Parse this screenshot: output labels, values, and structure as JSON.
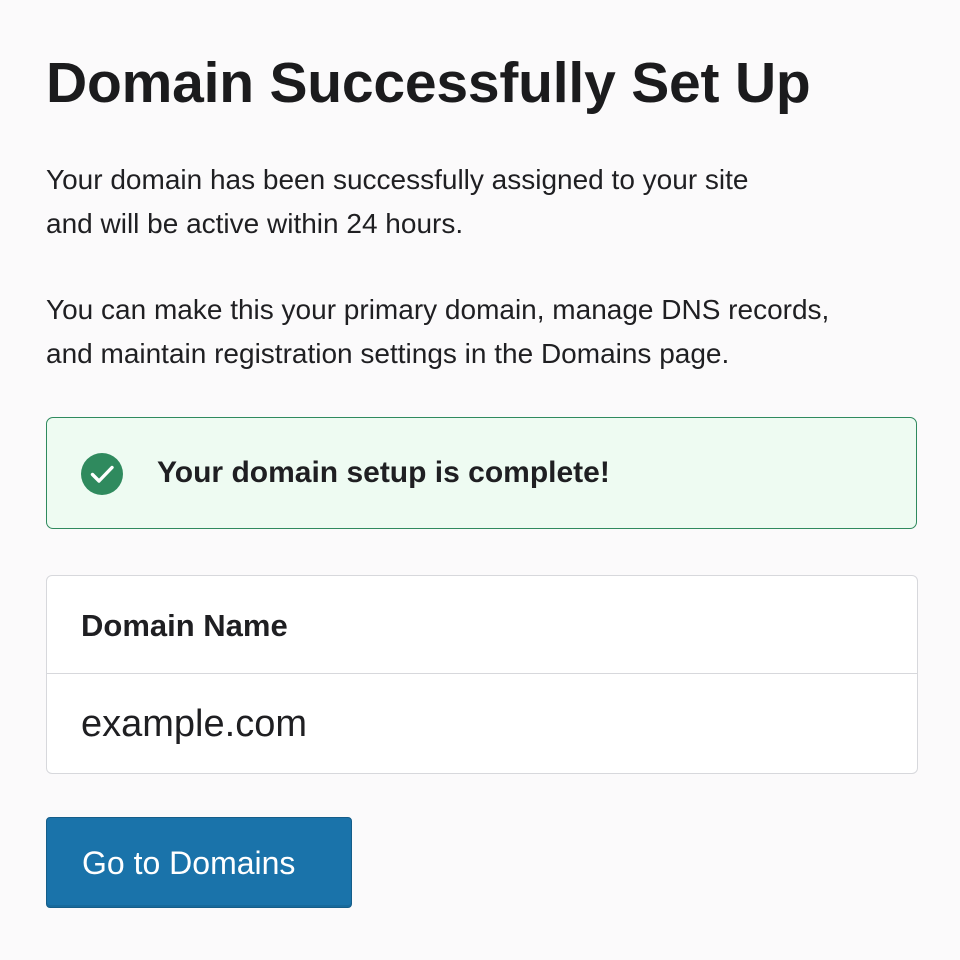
{
  "header": {
    "title": "Domain Successfully Set Up"
  },
  "content": {
    "paragraphs": [
      {
        "lines": [
          "Your domain has been successfully assigned to your site",
          "and will be active within 24 hours."
        ]
      },
      {
        "lines": [
          "You can make this your primary domain, manage DNS records,",
          "and maintain registration settings in the Domains page."
        ]
      }
    ]
  },
  "banner": {
    "icon": "check-circle-icon",
    "message": "Your domain setup is complete!",
    "colors": {
      "border": "#2f8a5e",
      "background": "#eefbf2",
      "icon": "#2f8a5e"
    }
  },
  "domain_table": {
    "columns": [
      "Domain Name"
    ],
    "rows": [
      [
        "example.com"
      ]
    ]
  },
  "actions": {
    "primary_label": "Go to Domains",
    "primary_color": "#1a73aa"
  }
}
